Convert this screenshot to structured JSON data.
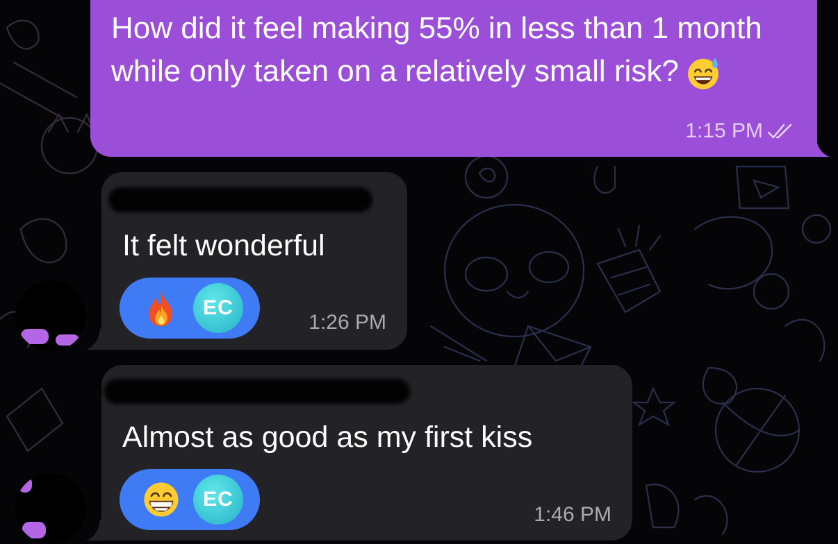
{
  "colors": {
    "background": "#050507",
    "outgoing_bubble": "#9b4fd8",
    "incoming_bubble": "#222227",
    "reaction_pill": "#3f7bf5",
    "reaction_avatar": "#3ccfd8"
  },
  "messages": [
    {
      "direction": "outgoing",
      "text": "How did it feel making 55% in less than 1 month while only taken on a relatively small risk?",
      "emoji": "grinning-face-with-sweat",
      "time": "1:15 PM",
      "status_icon": "double-check-read-icon"
    },
    {
      "direction": "incoming",
      "sender_redacted": true,
      "text": "It felt wonderful",
      "reaction": {
        "emoji": "fire",
        "avatar_initials": "EC"
      },
      "time": "1:26 PM"
    },
    {
      "direction": "incoming",
      "sender_redacted": true,
      "text": "Almost as good as my first kiss",
      "reaction": {
        "emoji": "grinning-face-with-smiling-eyes",
        "avatar_initials": "EC"
      },
      "time": "1:46 PM"
    }
  ]
}
